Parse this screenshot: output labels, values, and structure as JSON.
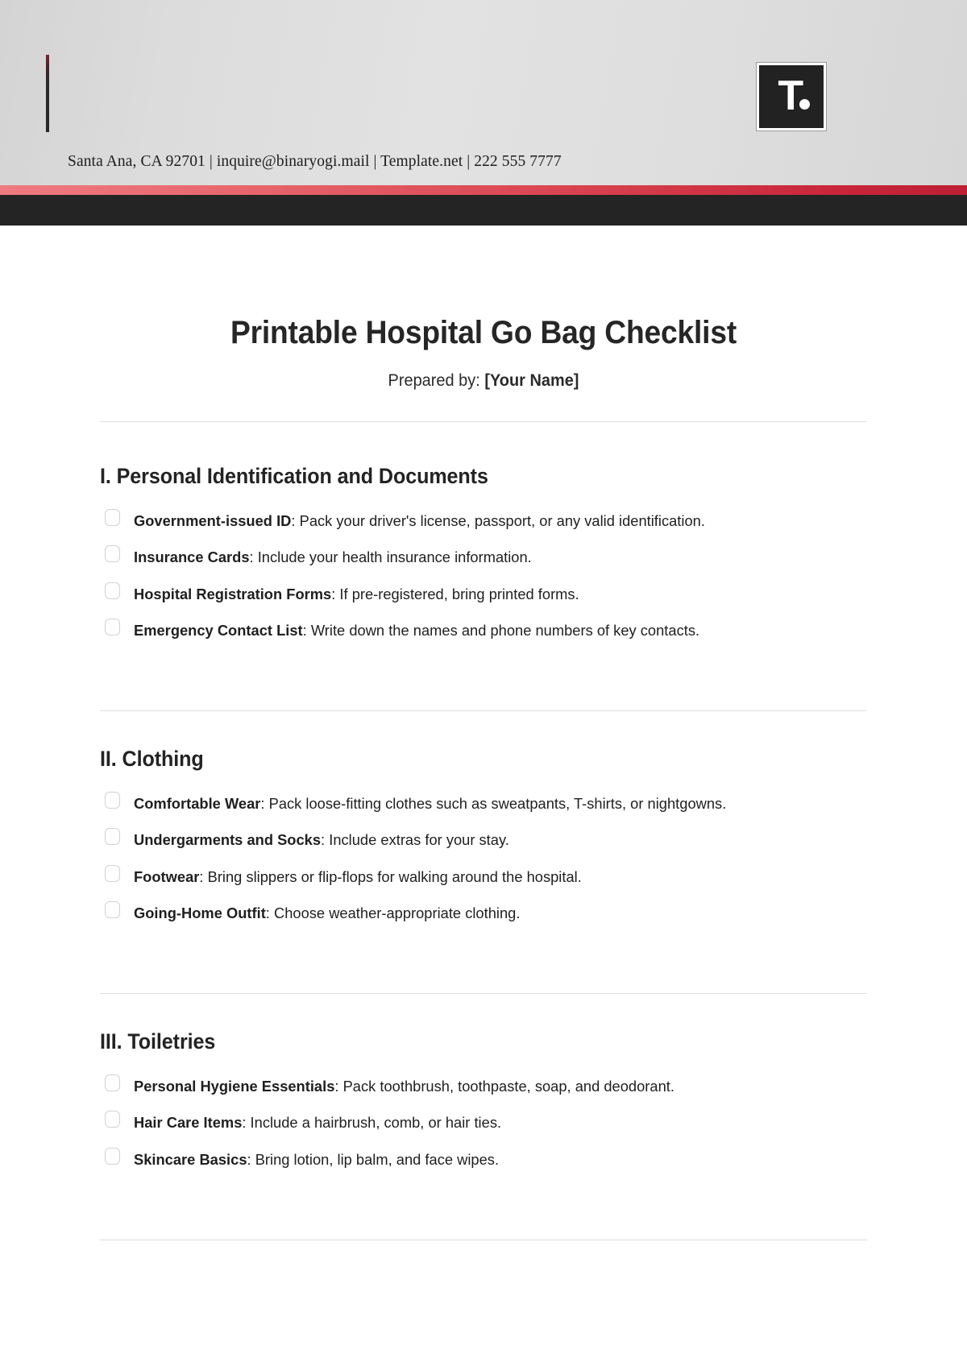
{
  "header": {
    "contact_line": "Santa Ana, CA 92701 | inquire@binaryogi.mail | Template.net | 222 555 7777",
    "logo_mark": "T",
    "accent_color": "#c9263a",
    "band_dark_color": "#242424"
  },
  "document": {
    "title": "Printable Hospital Go Bag Checklist",
    "prepared_by_label": "Prepared by:",
    "prepared_by_value": "[Your Name]"
  },
  "sections": [
    {
      "heading": "I. Personal Identification and Documents",
      "items": [
        {
          "label": "Government-issued ID",
          "separator": ":",
          "description": " Pack your driver's license, passport, or any valid identification."
        },
        {
          "label": "Insurance Cards",
          "separator": ":",
          "description": " Include your health insurance information."
        },
        {
          "label": "Hospital Registration Forms",
          "separator": ":",
          "description": " If pre-registered, bring printed forms."
        },
        {
          "label": "Emergency Contact List",
          "separator": ":",
          "description": " Write down the names and phone numbers of key contacts."
        }
      ]
    },
    {
      "heading": "II. Clothing",
      "items": [
        {
          "label": "Comfortable Wear",
          "separator": ":",
          "description": " Pack loose-fitting clothes such as sweatpants, T-shirts, or nightgowns."
        },
        {
          "label": "Undergarments and Socks",
          "separator": ":",
          "description": " Include extras for your stay."
        },
        {
          "label": "Footwear",
          "separator": ":",
          "description": " Bring slippers or flip-flops for walking around the hospital."
        },
        {
          "label": "Going-Home Outfit",
          "separator": ":",
          "description": " Choose weather-appropriate clothing."
        }
      ]
    },
    {
      "heading": "III. Toiletries",
      "items": [
        {
          "label": "Personal Hygiene Essentials",
          "separator": ":",
          "description": " Pack toothbrush, toothpaste, soap, and deodorant."
        },
        {
          "label": "Hair Care Items",
          "separator": ":",
          "description": " Include a hairbrush, comb, or hair ties."
        },
        {
          "label": "Skincare Basics",
          "separator": ":",
          "description": " Bring lotion, lip balm, and face wipes."
        }
      ]
    }
  ]
}
